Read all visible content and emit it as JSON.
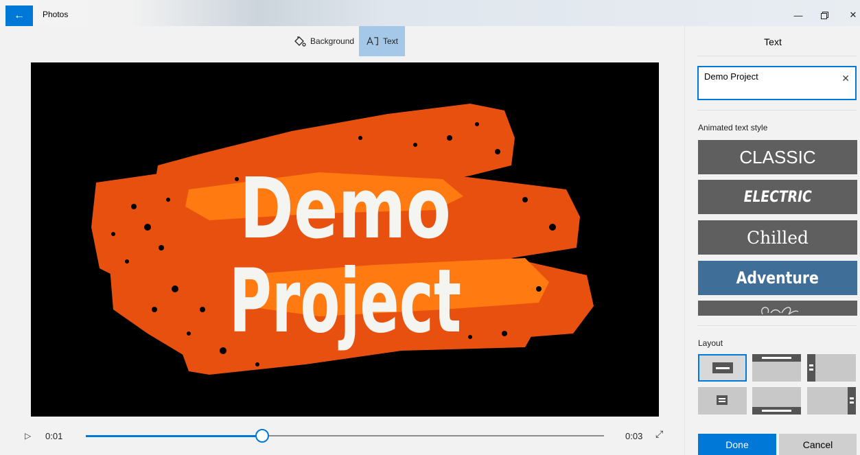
{
  "window": {
    "title": "Photos"
  },
  "toolbar": {
    "background_label": "Background",
    "text_label": "Text"
  },
  "preview": {
    "line1": "Demo",
    "line2": "Project"
  },
  "playback": {
    "current_time": "0:01",
    "end_time": "0:03",
    "progress": 0.34
  },
  "panel": {
    "title": "Text",
    "input_value": "Demo Project",
    "styles_label": "Animated text style",
    "styles": [
      "CLASSIC",
      "ELECTRIC",
      "Chilled",
      "Adventure"
    ],
    "selected_style": "Adventure",
    "layout_label": "Layout",
    "done_label": "Done",
    "cancel_label": "Cancel"
  },
  "colors": {
    "accent": "#0078d7",
    "brush_dark": "#e8500f",
    "brush_light": "#ff7a10",
    "tile": "#5f5f5f",
    "tile_selected": "#3f6e98"
  }
}
